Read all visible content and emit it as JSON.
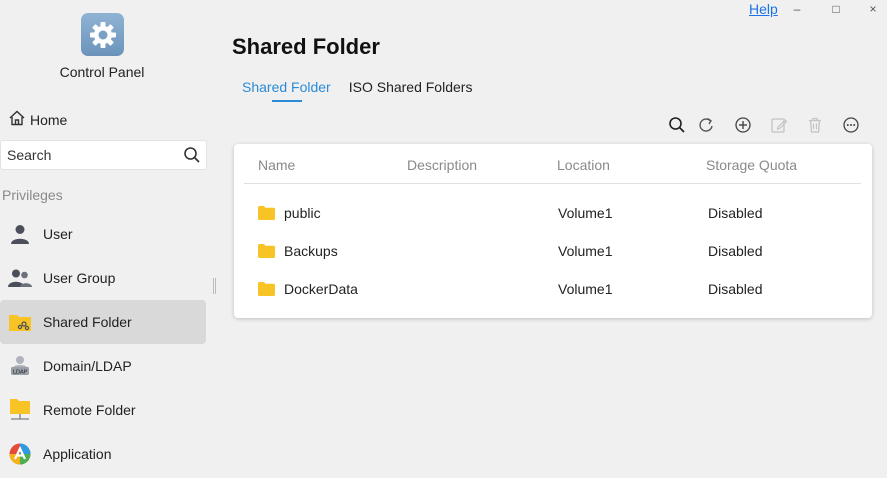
{
  "window": {
    "help_label": "Help",
    "minimize_glyph": "–",
    "maximize_glyph": "□",
    "close_glyph": "×"
  },
  "sidebar": {
    "app_title": "Control Panel",
    "app_icon": "gear-icon",
    "home_label": "Home",
    "search_placeholder": "Search",
    "section_label": "Privileges",
    "items": [
      {
        "label": "User",
        "icon": "user-icon"
      },
      {
        "label": "User Group",
        "icon": "user-group-icon"
      },
      {
        "label": "Shared Folder",
        "icon": "shared-folder-icon",
        "active": true
      },
      {
        "label": "Domain/LDAP",
        "icon": "ldap-icon"
      },
      {
        "label": "Remote Folder",
        "icon": "remote-folder-icon"
      },
      {
        "label": "Application",
        "icon": "application-icon"
      }
    ]
  },
  "main": {
    "title": "Shared Folder",
    "tabs": [
      {
        "label": "Shared Folder",
        "active": true
      },
      {
        "label": "ISO Shared Folders",
        "active": false
      }
    ],
    "toolbar": [
      "search-icon",
      "refresh-icon",
      "add-icon",
      "edit-icon",
      "delete-icon",
      "more-icon"
    ],
    "table": {
      "columns": [
        "Name",
        "Description",
        "Location",
        "Storage Quota"
      ],
      "rows": [
        {
          "name": "public",
          "description": "",
          "location": "Volume1",
          "quota": "Disabled"
        },
        {
          "name": "Backups",
          "description": "",
          "location": "Volume1",
          "quota": "Disabled"
        },
        {
          "name": "DockerData",
          "description": "",
          "location": "Volume1",
          "quota": "Disabled"
        }
      ]
    }
  },
  "colors": {
    "accent": "#2b8bd6",
    "folder": "#f7c325",
    "active_bg": "#d9d9d9",
    "background": "#f0f0f0"
  }
}
